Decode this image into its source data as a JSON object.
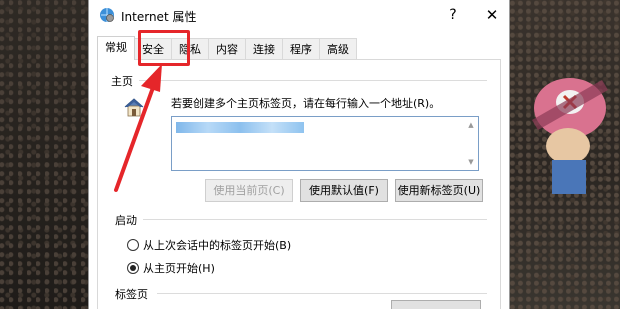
{
  "window": {
    "title": "Internet 属性",
    "help_glyph": "?",
    "close_glyph": "✕"
  },
  "tabs": [
    {
      "label": "常规",
      "active": true
    },
    {
      "label": "安全",
      "active": false
    },
    {
      "label": "隐私",
      "active": false
    },
    {
      "label": "内容",
      "active": false
    },
    {
      "label": "连接",
      "active": false
    },
    {
      "label": "程序",
      "active": false
    },
    {
      "label": "高级",
      "active": false
    }
  ],
  "home": {
    "section_label": "主页",
    "hint": "若要创建多个主页标签页，请在每行输入一个地址(R)。",
    "buttons": {
      "use_current": "使用当前页(C)",
      "use_default": "使用默认值(F)",
      "use_new_tab": "使用新标签页(U)"
    }
  },
  "startup": {
    "section_label": "启动",
    "options": [
      {
        "label": "从上次会话中的标签页开始(B)",
        "checked": false
      },
      {
        "label": "从主页开始(H)",
        "checked": true
      }
    ]
  },
  "tabs_section": {
    "section_label": "标签页"
  },
  "colors": {
    "annotation": "#e5262a",
    "url_highlight": "#8cc0ee"
  },
  "icons": {
    "window_icon": "internet-options-icon",
    "home_icon": "house-icon"
  }
}
